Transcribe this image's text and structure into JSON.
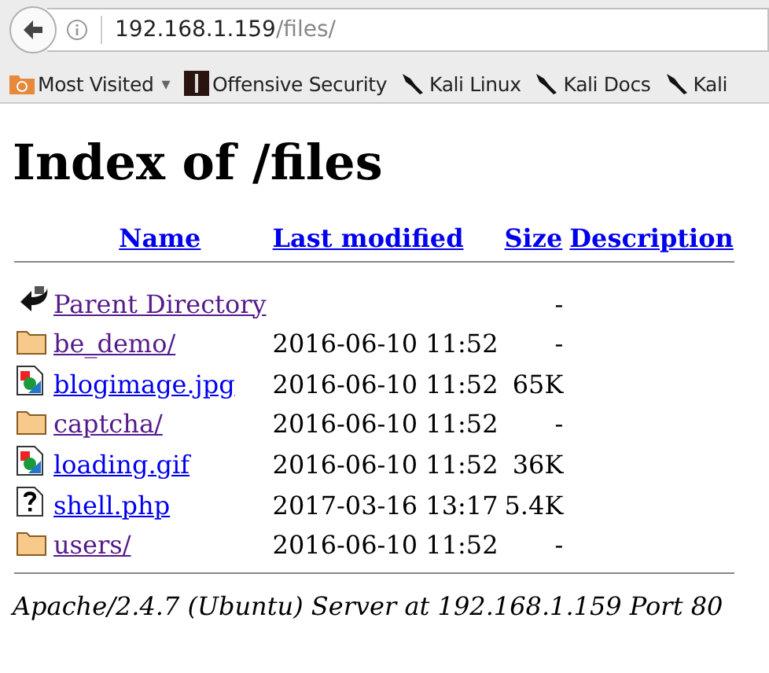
{
  "address_bar": {
    "host": "192.168.1.159",
    "path": "/files/"
  },
  "bookmarks": [
    {
      "kind": "folder",
      "label": "Most Visited",
      "dropdown": "▾"
    },
    {
      "kind": "offsec",
      "label": "Offensive Security"
    },
    {
      "kind": "kali",
      "label": "Kali Linux"
    },
    {
      "kind": "kali",
      "label": "Kali Docs"
    },
    {
      "kind": "kali",
      "label": "Kali"
    }
  ],
  "page": {
    "title": "Index of /files",
    "columns": [
      "Name",
      "Last modified",
      "Size",
      "Description"
    ],
    "rows": [
      {
        "kind": "back",
        "name": "Parent Directory",
        "modified": "",
        "size": "-",
        "visited": true
      },
      {
        "kind": "folder",
        "name": "be_demo/",
        "modified": "2016-06-10 11:52",
        "size": "-",
        "visited": true
      },
      {
        "kind": "image",
        "name": "blogimage.jpg",
        "modified": "2016-06-10 11:52",
        "size": "65K",
        "visited": false
      },
      {
        "kind": "folder",
        "name": "captcha/",
        "modified": "2016-06-10 11:52",
        "size": "-",
        "visited": true
      },
      {
        "kind": "image",
        "name": "loading.gif",
        "modified": "2016-06-10 11:52",
        "size": "36K",
        "visited": false
      },
      {
        "kind": "unknown",
        "name": "shell.php",
        "modified": "2017-03-16 13:17",
        "size": "5.4K",
        "visited": false
      },
      {
        "kind": "folder",
        "name": "users/",
        "modified": "2016-06-10 11:52",
        "size": "-",
        "visited": true
      }
    ],
    "footer": "Apache/2.4.7 (Ubuntu) Server at 192.168.1.159 Port 80"
  }
}
